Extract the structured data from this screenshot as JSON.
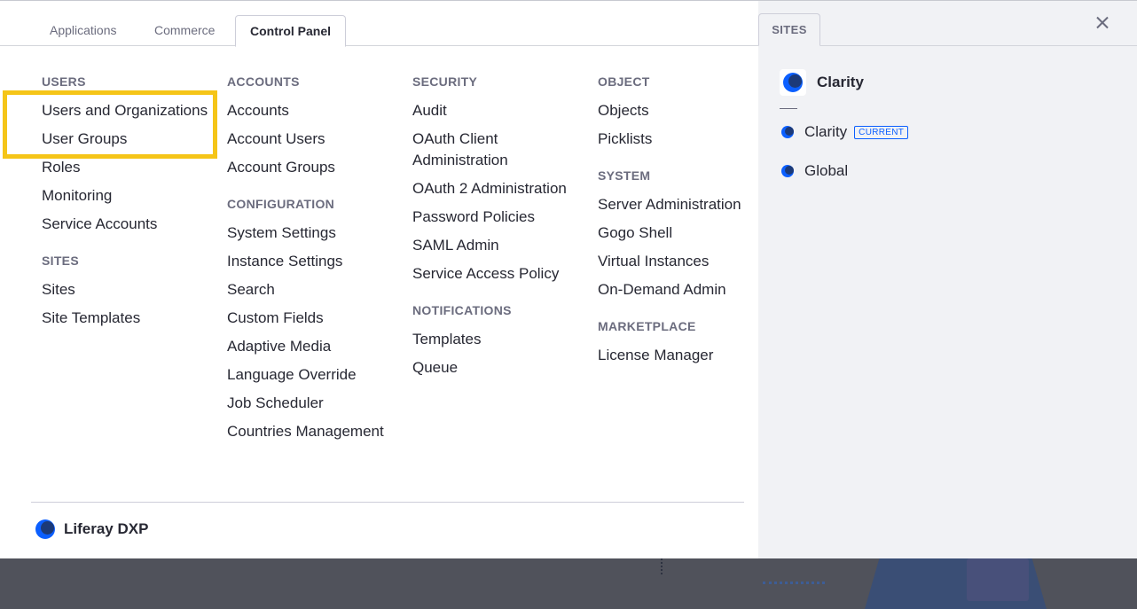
{
  "tabs": [
    {
      "label": "Applications"
    },
    {
      "label": "Commerce"
    },
    {
      "label": "Control Panel"
    }
  ],
  "columns": [
    {
      "sections": [
        {
          "title": "USERS",
          "items": [
            "Users and Organizations",
            "User Groups",
            "Roles",
            "Monitoring",
            "Service Accounts"
          ]
        },
        {
          "title": "SITES",
          "items": [
            "Sites",
            "Site Templates"
          ]
        }
      ]
    },
    {
      "sections": [
        {
          "title": "ACCOUNTS",
          "items": [
            "Accounts",
            "Account Users",
            "Account Groups"
          ]
        },
        {
          "title": "CONFIGURATION",
          "items": [
            "System Settings",
            "Instance Settings",
            "Search",
            "Custom Fields",
            "Adaptive Media",
            "Language Override",
            "Job Scheduler",
            "Countries Management"
          ]
        }
      ]
    },
    {
      "sections": [
        {
          "title": "SECURITY",
          "items": [
            "Audit",
            "OAuth Client Administration",
            "OAuth 2 Administration",
            "Password Policies",
            "SAML Admin",
            "Service Access Policy"
          ]
        },
        {
          "title": "NOTIFICATIONS",
          "items": [
            "Templates",
            "Queue"
          ]
        }
      ]
    },
    {
      "sections": [
        {
          "title": "OBJECT",
          "items": [
            "Objects",
            "Picklists"
          ]
        },
        {
          "title": "SYSTEM",
          "items": [
            "Server Administration",
            "Gogo Shell",
            "Virtual Instances",
            "On-Demand Admin"
          ]
        },
        {
          "title": "MARKETPLACE",
          "items": [
            "License Manager"
          ]
        }
      ]
    }
  ],
  "footer": {
    "brand": "Liferay DXP"
  },
  "sites_panel": {
    "tab_label": "SITES",
    "current_site": "Clarity",
    "items": [
      {
        "label": "Clarity",
        "badge": "CURRENT"
      },
      {
        "label": "Global",
        "badge": ""
      }
    ]
  },
  "colors": {
    "accent": "#0b5fff",
    "highlight": "#f5c518",
    "text": "#272833",
    "muted": "#6b6c7e"
  }
}
